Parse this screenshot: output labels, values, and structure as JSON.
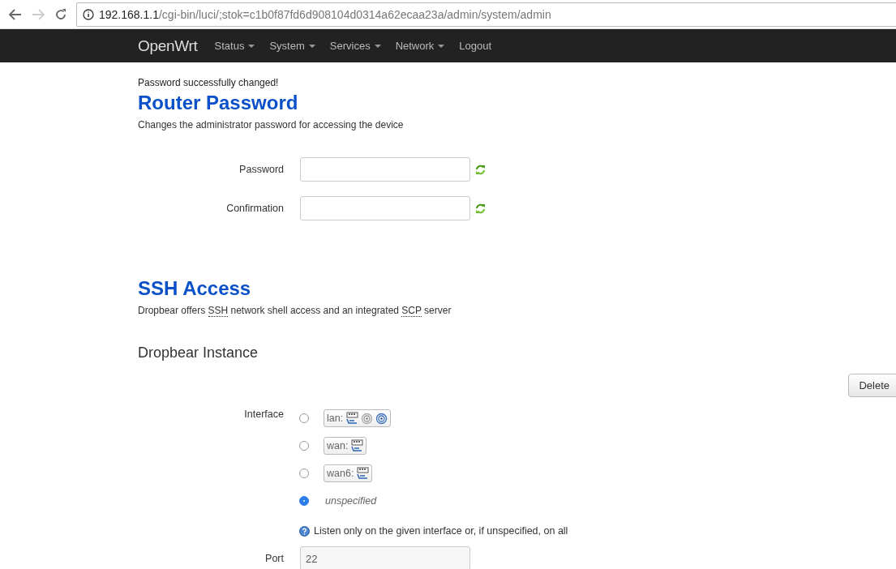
{
  "browser": {
    "url_host": "192.168.1.1",
    "url_path": "/cgi-bin/luci/;stok=c1b0f87fd6d908104d0314a62ecaa23a/admin/system/admin"
  },
  "navbar": {
    "brand": "OpenWrt",
    "menus": [
      {
        "label": "Status",
        "dropdown": true
      },
      {
        "label": "System",
        "dropdown": true
      },
      {
        "label": "Services",
        "dropdown": true
      },
      {
        "label": "Network",
        "dropdown": true
      },
      {
        "label": "Logout",
        "dropdown": false
      }
    ]
  },
  "status_message": "Password successfully changed!",
  "router_password": {
    "title": "Router Password",
    "description": "Changes the administrator password for accessing the device",
    "fields": [
      {
        "label": "Password"
      },
      {
        "label": "Confirmation"
      }
    ]
  },
  "ssh_access": {
    "title": "SSH Access",
    "description": [
      {
        "text": "Dropbear offers ",
        "abbr": false
      },
      {
        "text": "SSH",
        "abbr": true
      },
      {
        "text": " network shell access and an integrated ",
        "abbr": false
      },
      {
        "text": "SCP",
        "abbr": true
      },
      {
        "text": " server",
        "abbr": false
      }
    ],
    "instance_title": "Dropbear Instance",
    "delete_button": "Delete",
    "interface": {
      "label": "Interface",
      "options": [
        {
          "kind": "network",
          "label": "lan:",
          "devices": [
            {
              "kind": "ethernet"
            },
            {
              "kind": "wireless_off"
            },
            {
              "kind": "wireless"
            }
          ],
          "selected": false
        },
        {
          "kind": "network",
          "label": "wan:",
          "devices": [
            {
              "kind": "ethernet"
            }
          ],
          "selected": false
        },
        {
          "kind": "network",
          "label": "wan6:",
          "devices": [
            {
              "kind": "ethernet"
            }
          ],
          "selected": false
        },
        {
          "kind": "plain",
          "label": "unspecified",
          "selected": true
        }
      ],
      "help": "Listen only on the given interface or, if unspecified, on all"
    },
    "port": {
      "label": "Port",
      "value": "22"
    }
  }
}
